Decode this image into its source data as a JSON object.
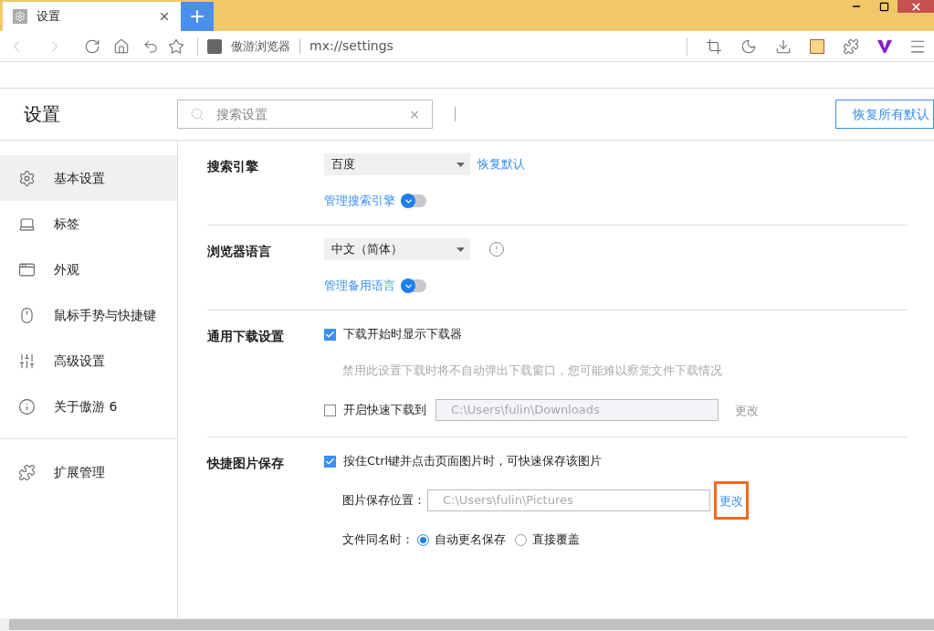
{
  "tabs": [
    {
      "title": "设置",
      "selected": true
    }
  ],
  "toolbar": {
    "site_name": "傲游浏览器",
    "url": "mx://settings"
  },
  "header": {
    "title": "设置",
    "search_placeholder": "搜索设置",
    "search_clear": "×",
    "reset_all_button": "恢复所有默认"
  },
  "sidebar": {
    "items": [
      {
        "label": "基本设置",
        "selected": true
      },
      {
        "label": "标签",
        "selected": false
      },
      {
        "label": "外观",
        "selected": false
      },
      {
        "label": "鼠标手势与快捷键",
        "selected": false
      },
      {
        "label": "高级设置",
        "selected": false
      },
      {
        "label": "关于傲游 6",
        "selected": false
      }
    ],
    "extra_items": [
      {
        "label": "扩展管理",
        "selected": false
      }
    ]
  },
  "sections": [
    {
      "title": "搜索引擎",
      "rows": [
        {
          "kind": "select",
          "value": "百度",
          "link": "恢复默认"
        },
        {
          "kind": "toggle",
          "label": "管理搜索引擎",
          "expanded": false
        }
      ]
    },
    {
      "title": "浏览器语言",
      "rows": [
        {
          "kind": "select",
          "value": "中文（简体）",
          "info": true
        },
        {
          "kind": "toggle",
          "label": "管理备用语言",
          "expanded": false
        }
      ]
    },
    {
      "title": "通用下载设置",
      "rows": [
        {
          "kind": "checkbox",
          "label": "下载开始时显示下载器",
          "checked": true
        },
        {
          "kind": "hint",
          "text": "禁用此设置下载时将不自动弹出下载窗口，您可能难以察觉文件下载情况"
        },
        {
          "kind": "checkbox_path",
          "label": "开启快速下载到",
          "checked": false,
          "path": "C:\\Users\\fulin\\Downloads",
          "button": "更改",
          "disabled": true,
          "highlighted": false
        }
      ]
    },
    {
      "title": "快捷图片保存",
      "rows": [
        {
          "kind": "checkbox",
          "label": "按住Ctrl键并点击页面图片时，可快速保存该图片",
          "checked": true
        },
        {
          "kind": "path",
          "label": "图片保存位置：",
          "path": "C:\\Users\\fulin\\Pictures",
          "button": "更改",
          "disabled": false,
          "highlighted": true
        },
        {
          "kind": "radios",
          "label": "文件同名时：",
          "options": [
            {
              "label": "自动更名保存",
              "selected": true
            },
            {
              "label": "直接覆盖",
              "selected": false
            }
          ]
        }
      ]
    }
  ]
}
